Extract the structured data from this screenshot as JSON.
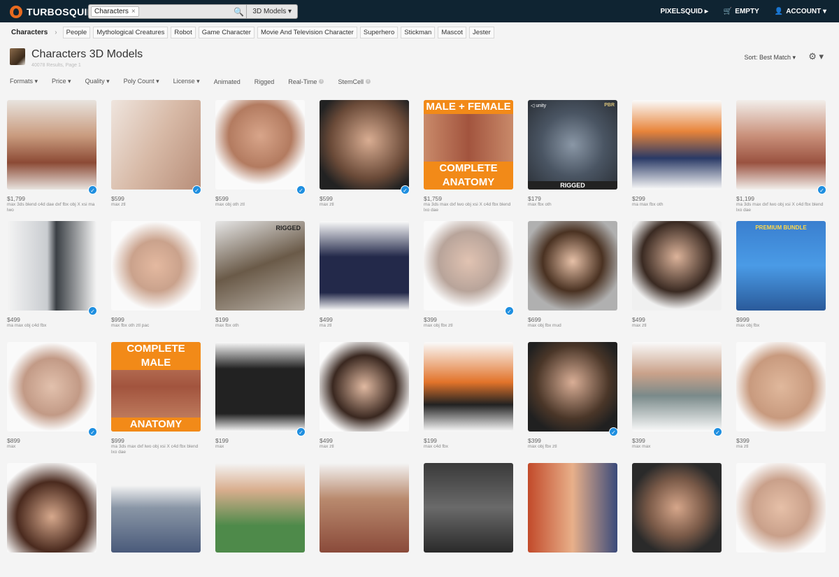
{
  "topbar": {
    "logo": "TURBOSQUID",
    "search_chip": "Characters",
    "search_chip_close": "×",
    "search_icon": "🔍",
    "search_category": "3D Models ▾",
    "pixelsquid": "PIXELSQUID ▸",
    "cart": "EMPTY",
    "cart_icon": "🛒",
    "account": "ACCOUNT ▾",
    "account_icon": "👤"
  },
  "breadcrumbs": {
    "current": "Characters",
    "sep": "›",
    "tags": [
      "People",
      "Mythological Creatures",
      "Robot",
      "Game Character",
      "Movie And Television Character",
      "Superhero",
      "Stickman",
      "Mascot",
      "Jester"
    ]
  },
  "page": {
    "title": "Characters 3D Models",
    "results": "40078 Results, Page 1",
    "sort": "Sort: Best Match ▾",
    "gear": "⚙ ▾"
  },
  "filters": [
    "Formats ▾",
    "Price ▾",
    "Quality ▾",
    "Poly Count ▾",
    "License ▾",
    "Animated",
    "Rigged",
    "Real-Time",
    "StemCell"
  ],
  "filter_info_mark": "i",
  "products": [
    {
      "price": "$1,799",
      "formats": "max 3ds blend c4d dae dxf fbx obj X xsi ma lwo",
      "check": true,
      "bg": "linear-gradient(180deg,#e8e3de,#c99b7e 40%,#8c4a35 70%,#e8e3de)"
    },
    {
      "price": "$599",
      "formats": "max ztl",
      "check": true,
      "bg": "linear-gradient(120deg,#efe5de,#d7b9a6 50%,#b88e79)"
    },
    {
      "price": "$599",
      "formats": "max obj oth ztl",
      "check": true,
      "bg": "radial-gradient(circle at 50% 40%,#d8a58a,#b37b60 45%,#fafafa 70%)"
    },
    {
      "price": "$599",
      "formats": "max ztl",
      "check": true,
      "bg": "radial-gradient(circle at 55% 45%,#d9ad92,#6a4a38 55%,#222 80%)"
    },
    {
      "price": "$1,759",
      "formats": "ma 3ds max dxf lwo obj xsi X c4d fbx blend lxo dae",
      "check": false,
      "bg": "linear-gradient(90deg,#c98a6a,#a2543e 50%,#c98a6a)",
      "top": "MALE + FEMALE",
      "bottom": "COMPLETE ANATOMY"
    },
    {
      "price": "$179",
      "formats": "max fbx oth",
      "check": false,
      "bg": "radial-gradient(circle at 50% 50%,#8a97a6,#4a5563 50%,#2a2f36)",
      "unity": "◁ unity",
      "pbr": "PBR",
      "rig": "RIGGED"
    },
    {
      "price": "$299",
      "formats": "ma max fbx oth",
      "check": false,
      "bg": "linear-gradient(180deg,#fafafa,#e8843a 35%,#2a3a66 65%,#fafafa)"
    },
    {
      "price": "$1,199",
      "formats": "ma 3ds max dxf lwo obj xsi X c4d fbx blend lxo dae",
      "check": true,
      "bg": "linear-gradient(180deg,#f2eeea,#c9907a 40%,#9a5240 70%,#f2eeea)"
    },
    {
      "price": "$499",
      "formats": "ma max obj c4d fbx",
      "check": true,
      "bg": "linear-gradient(90deg,#f4f4f4,#c9ccd0 45%,#3a3f44 55%,#f4f4f4)"
    },
    {
      "price": "$999",
      "formats": "max fbx oth ztl pac",
      "check": false,
      "bg": "radial-gradient(circle at 50% 50%,#e4b9a0,#caa28c 40%,#fafafa 70%)"
    },
    {
      "price": "$199",
      "formats": "max fbx oth",
      "check": false,
      "bg": "linear-gradient(160deg,#e6e6e6,#6a5a48 50%,#b8b0a6)",
      "rigtop": "RIGGED"
    },
    {
      "price": "$499",
      "formats": "ma ztl",
      "check": false,
      "bg": "linear-gradient(180deg,#fafafa,#23294a 40%,#23294a 80%,#fafafa)"
    },
    {
      "price": "$399",
      "formats": "max obj fbx ztl",
      "check": true,
      "bg": "radial-gradient(circle at 50% 45%,#e1c3b2,#b8a49a 45%,#fafafa 70%)"
    },
    {
      "price": "$699",
      "formats": "max obj fbx mud",
      "check": false,
      "bg": "radial-gradient(circle at 50% 45%,#e6c0a7,#4a3222 45%,#b0b0b0 75%)"
    },
    {
      "price": "$499",
      "formats": "max ztl",
      "check": false,
      "bg": "radial-gradient(circle at 50% 40%,#dcb39a,#3a2a22 50%,#f0f0f0 75%)"
    },
    {
      "price": "$999",
      "formats": "max obj fbx",
      "check": false,
      "bg": "linear-gradient(180deg,#3a7fcf,#4a9be6 50%,#2a5a9a)",
      "bundle": "PREMIUM BUNDLE"
    },
    {
      "price": "$899",
      "formats": "max",
      "check": true,
      "bg": "radial-gradient(circle at 50% 50%,#e2c1ad,#c29a86 45%,#fafafa 70%)"
    },
    {
      "price": "$999",
      "formats": "ma 3ds max dxf lwo obj xsi X c4d fbx blend lxo dae",
      "check": false,
      "bg": "linear-gradient(180deg,#c98a6a,#a2543e 50%,#c98a6a)",
      "top": "COMPLETE MALE",
      "bottom": "ANATOMY"
    },
    {
      "price": "$199",
      "formats": "max",
      "check": true,
      "bg": "linear-gradient(180deg,#fafafa,#222 30%,#222 80%,#fafafa)"
    },
    {
      "price": "$499",
      "formats": "max ztl",
      "check": false,
      "bg": "radial-gradient(circle at 50% 50%,#e0b9a1,#3a2820 50%,#fafafa 78%)"
    },
    {
      "price": "$199",
      "formats": "max c4d fbx",
      "check": false,
      "bg": "linear-gradient(180deg,#fafafa,#e2732a 45%,#222 70%,#fafafa)"
    },
    {
      "price": "$399",
      "formats": "max obj fbx ztl",
      "check": true,
      "bg": "radial-gradient(circle at 50% 45%,#d9ae96,#4a3628 55%,#202020 80%)"
    },
    {
      "price": "$399",
      "formats": "max max",
      "check": true,
      "bg": "linear-gradient(180deg,#fafafa,#caa28a 35%,#7a8a8a 60%,#fafafa)"
    },
    {
      "price": "$399",
      "formats": "ma ztl",
      "check": false,
      "bg": "radial-gradient(circle at 50% 50%,#e0b89c,#c89a7e 50%,#fafafa 75%)"
    },
    {
      "bg": "radial-gradient(circle at 50% 60%,#d6a88c,#4a2a1e 50%,#fafafa 80%)"
    },
    {
      "bg": "linear-gradient(180deg,#f4f4f4,#f4f4f4 25%,#8a96a6 50%,#4a5a7a)"
    },
    {
      "bg": "linear-gradient(180deg,#f4f4f4,#d9ae8e 30%,#4e8a4a 70%)"
    },
    {
      "bg": "linear-gradient(180deg,#f4f4f4,#b98a6e 40%,#8a4a3a)"
    },
    {
      "bg": "linear-gradient(180deg,#3a3a3a,#6a6a6a 50%,#2a2a2a)"
    },
    {
      "bg": "linear-gradient(90deg,#c24a2a,#e8b08a 50%,#3a4a7a)"
    },
    {
      "bg": "radial-gradient(circle at 50% 50%,#d6a68a,#7a5a48 45%,#2a2a2a 75%)"
    },
    {
      "bg": "radial-gradient(circle at 50% 50%,#e6c0a8,#c9a08a 45%,#fafafa 75%)"
    }
  ]
}
